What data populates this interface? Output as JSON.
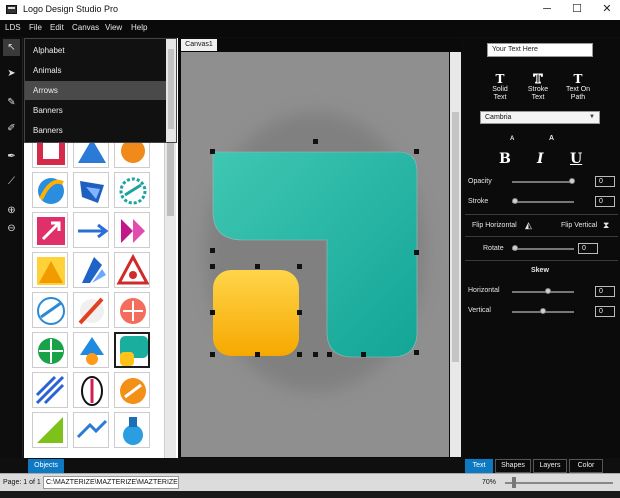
{
  "window": {
    "title": "Logo Design Studio Pro",
    "minimize_glyph": "─",
    "maximize_glyph": "☐",
    "close_glyph": "✕"
  },
  "menu": [
    "LDS",
    "File",
    "Edit",
    "Canvas",
    "View",
    "Help"
  ],
  "tools": [
    {
      "name": "pointer-tool-icon",
      "glyph": "↖",
      "active": true
    },
    {
      "name": "select-tool-icon",
      "glyph": "➤",
      "active": false
    },
    {
      "name": "pen-tool-icon",
      "glyph": "✎",
      "active": false
    },
    {
      "name": "brush-tool-icon",
      "glyph": "✐",
      "active": false
    },
    {
      "name": "eyedropper-tool-icon",
      "glyph": "✒",
      "active": false
    },
    {
      "name": "line-tool-icon",
      "glyph": "⟋",
      "active": false
    },
    {
      "name": "zoom-in-icon",
      "glyph": "⊕",
      "active": false
    },
    {
      "name": "zoom-out-icon",
      "glyph": "⊖",
      "active": false
    }
  ],
  "category_dropdown": {
    "items": [
      "Alphabet",
      "Animals",
      "Arrows",
      "Banners",
      "Banners"
    ],
    "highlighted_index": 2
  },
  "canvas": {
    "tab_label": "Canvas1",
    "colors": {
      "teal": "#1aae9f",
      "teal_light": "#3fc7b2",
      "yellow": "#ffc21a",
      "orange": "#f5a000"
    }
  },
  "text_panel": {
    "text_value": "Your Text Here",
    "buttons": [
      {
        "label": "Solid\nText",
        "glyph": "T"
      },
      {
        "label": "Stroke\nText",
        "glyph": "T"
      },
      {
        "label": "Text On\nPath",
        "glyph": "T"
      }
    ],
    "font": "Cambria",
    "size_glyph": "A",
    "bold": "B",
    "italic": "I",
    "underline": "U",
    "opacity_label": "Opacity",
    "opacity_value": "0",
    "stroke_label": "Stroke",
    "stroke_value": "0",
    "flip_h_label": "Flip Horizontal",
    "flip_v_label": "Flip Vertical",
    "rotate_label": "Rotate",
    "rotate_value": "0",
    "skew_title": "Skew",
    "horizontal_label": "Horizontal",
    "horizontal_value": "0",
    "vertical_label": "Vertical",
    "vertical_value": "0"
  },
  "bottom_tabs": {
    "objects": "Objects",
    "right": [
      "Text",
      "Shapes",
      "Layers",
      "Color"
    ],
    "active_right": "Text"
  },
  "status": {
    "page": "Page: 1 of 1",
    "path": "C:\\MAZTERIZE\\MAZTERIZE\\MAZTERIZE.ldsv",
    "zoom": "70%"
  }
}
